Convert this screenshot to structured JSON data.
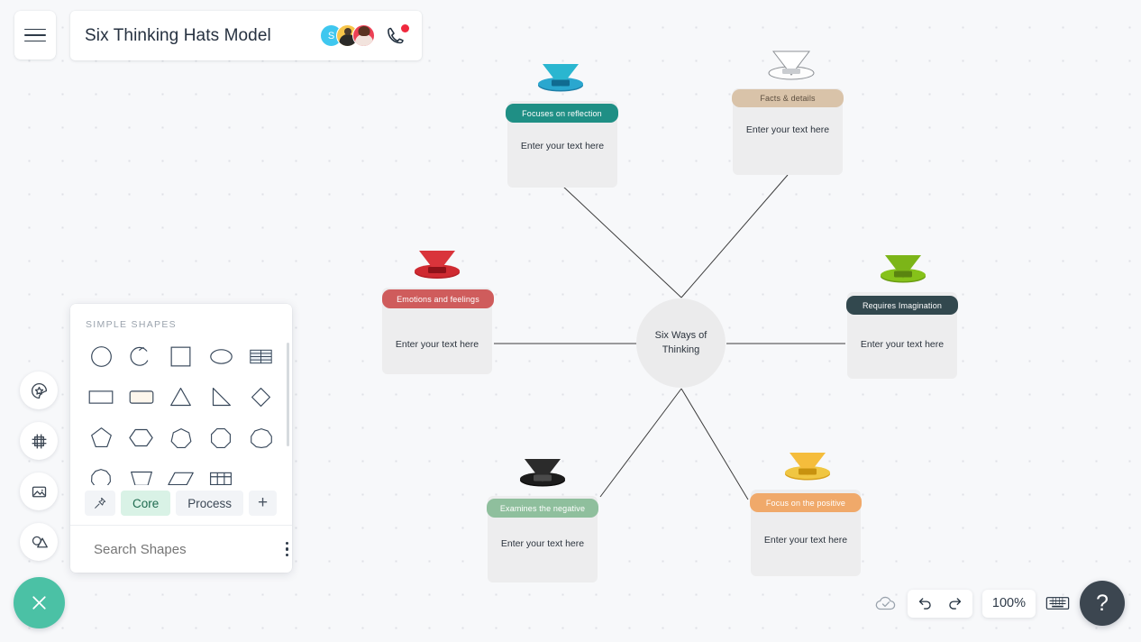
{
  "header": {
    "menu_icon": "hamburger-icon",
    "title": "Six Thinking Hats Model",
    "avatars": [
      {
        "name": "avatar-s",
        "initial": "S",
        "color": "#3fc7ef"
      },
      {
        "name": "avatar-2",
        "initial": "",
        "color": "#f7c54a"
      },
      {
        "name": "avatar-3",
        "initial": "",
        "color": "#ec4055"
      }
    ],
    "call_icon": "phone-icon",
    "call_badge_color": "#f0293e"
  },
  "sidebar": {
    "items": [
      {
        "name": "sidebar-item-stickers",
        "icon": "sticker-star-icon"
      },
      {
        "name": "sidebar-item-frames",
        "icon": "frame-icon"
      },
      {
        "name": "sidebar-item-images",
        "icon": "image-icon"
      },
      {
        "name": "sidebar-item-shapes",
        "icon": "shapes-icon"
      }
    ],
    "close_icon": "close-icon",
    "close_color": "#4bc1a5"
  },
  "shapes_panel": {
    "section_title": "SIMPLE SHAPES",
    "shapes": [
      {
        "name": "shape-circle",
        "icon": "circle-icon"
      },
      {
        "name": "shape-arc",
        "icon": "arc-icon"
      },
      {
        "name": "shape-square",
        "icon": "square-icon"
      },
      {
        "name": "shape-ellipse",
        "icon": "ellipse-icon"
      },
      {
        "name": "shape-lined-table",
        "icon": "lined-table-icon"
      },
      {
        "name": "shape-rectangle",
        "icon": "rectangle-icon"
      },
      {
        "name": "shape-rounded-rectangle",
        "icon": "rounded-rectangle-icon"
      },
      {
        "name": "shape-triangle",
        "icon": "triangle-icon"
      },
      {
        "name": "shape-right-triangle",
        "icon": "right-triangle-icon"
      },
      {
        "name": "shape-diamond",
        "icon": "diamond-icon"
      },
      {
        "name": "shape-pentagon",
        "icon": "pentagon-icon"
      },
      {
        "name": "shape-hexagon",
        "icon": "hexagon-icon"
      },
      {
        "name": "shape-heptagon",
        "icon": "heptagon-icon"
      },
      {
        "name": "shape-octagon",
        "icon": "octagon-icon"
      },
      {
        "name": "shape-nonagon",
        "icon": "nonagon-icon"
      },
      {
        "name": "shape-decagon",
        "icon": "decagon-icon"
      },
      {
        "name": "shape-trapezoid",
        "icon": "trapezoid-icon"
      },
      {
        "name": "shape-parallelogram",
        "icon": "parallelogram-icon"
      },
      {
        "name": "shape-grid-table",
        "icon": "grid-table-icon"
      }
    ],
    "tabs": [
      {
        "name": "tab-pinned",
        "label": "",
        "icon": "pin-icon",
        "active": false
      },
      {
        "name": "tab-core",
        "label": "Core",
        "active": true
      },
      {
        "name": "tab-process",
        "label": "Process",
        "active": false
      },
      {
        "name": "tab-add",
        "label": "+",
        "active": false
      }
    ],
    "search": {
      "placeholder": "Search Shapes",
      "value": "",
      "icon": "search-icon",
      "menu_icon": "kebab-menu-icon"
    }
  },
  "diagram": {
    "center": {
      "name": "center-node",
      "label_line1": "Six Ways of",
      "label_line2": "Thinking"
    },
    "body_placeholder": "Enter your text here",
    "nodes": [
      {
        "name": "node-blue-hat",
        "hat_color": "#2ab6d0",
        "hat_brim_color": "#1d7fa8",
        "header": "Focuses on reflection",
        "header_color": "#1f8f85",
        "body": "Enter your text here"
      },
      {
        "name": "node-white-hat",
        "hat_color": "#ffffff",
        "hat_brim_color": "#b9bcbf",
        "header": "Facts & details",
        "header_color": "#d9c3a9",
        "body": "Enter your text here"
      },
      {
        "name": "node-red-hat",
        "hat_color": "#d9343b",
        "hat_brim_color": "#b51f26",
        "header": "Emotions and feelings",
        "header_color": "#cf5c5c",
        "body": "Enter your text here"
      },
      {
        "name": "node-green-hat",
        "hat_color": "#7cb518",
        "hat_brim_color": "#6a9c12",
        "header": "Requires Imagination",
        "header_color": "#32484e",
        "body": "Enter your text here"
      },
      {
        "name": "node-black-hat",
        "hat_color": "#2b2b2b",
        "hat_brim_color": "#111111",
        "header": "Examines the negative",
        "header_color": "#8fbf9d",
        "body": "Enter your text here"
      },
      {
        "name": "node-yellow-hat",
        "hat_color": "#f5bd3c",
        "hat_brim_color": "#d8a11c",
        "header": "Focus on the positive",
        "header_color": "#f0a96a",
        "body": "Enter your text here"
      }
    ]
  },
  "statusbar": {
    "save_icon": "cloud-check-icon",
    "undo_icon": "undo-icon",
    "redo_icon": "redo-icon",
    "zoom_level": "100%",
    "keyboard_icon": "keyboard-icon",
    "help_label": "?"
  }
}
